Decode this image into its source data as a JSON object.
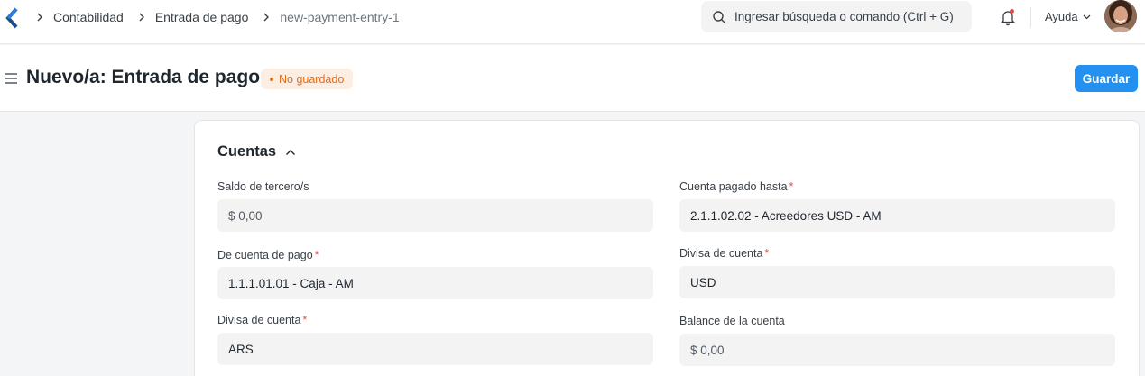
{
  "navbar": {
    "breadcrumbs": [
      "Contabilidad",
      "Entrada de pago",
      "new-payment-entry-1"
    ],
    "search_placeholder": "Ingresar búsqueda o comando (Ctrl + G)",
    "help_label": "Ayuda"
  },
  "page": {
    "title": "Nuevo/a: Entrada de pago",
    "status": "No guardado",
    "save_label": "Guardar"
  },
  "section": {
    "title": "Cuentas"
  },
  "fields": {
    "party_balance": {
      "label": "Saldo de tercero/s",
      "value": "$ 0,00"
    },
    "paid_from": {
      "label": "De cuenta de pago",
      "value": "1.1.1.01.01 - Caja - AM"
    },
    "paid_from_currency": {
      "label": "Divisa de cuenta",
      "value": "ARS"
    },
    "paid_to": {
      "label": "Cuenta pagado hasta",
      "value": "2.1.1.02.02 - Acreedores USD - AM"
    },
    "paid_to_currency": {
      "label": "Divisa de cuenta",
      "value": "USD"
    },
    "account_balance": {
      "label": "Balance de la cuenta",
      "value": "$ 0,00"
    }
  },
  "colors": {
    "primary": "#2490ef",
    "status_orange": "#e86c13",
    "required_red": "#e24c4c"
  }
}
